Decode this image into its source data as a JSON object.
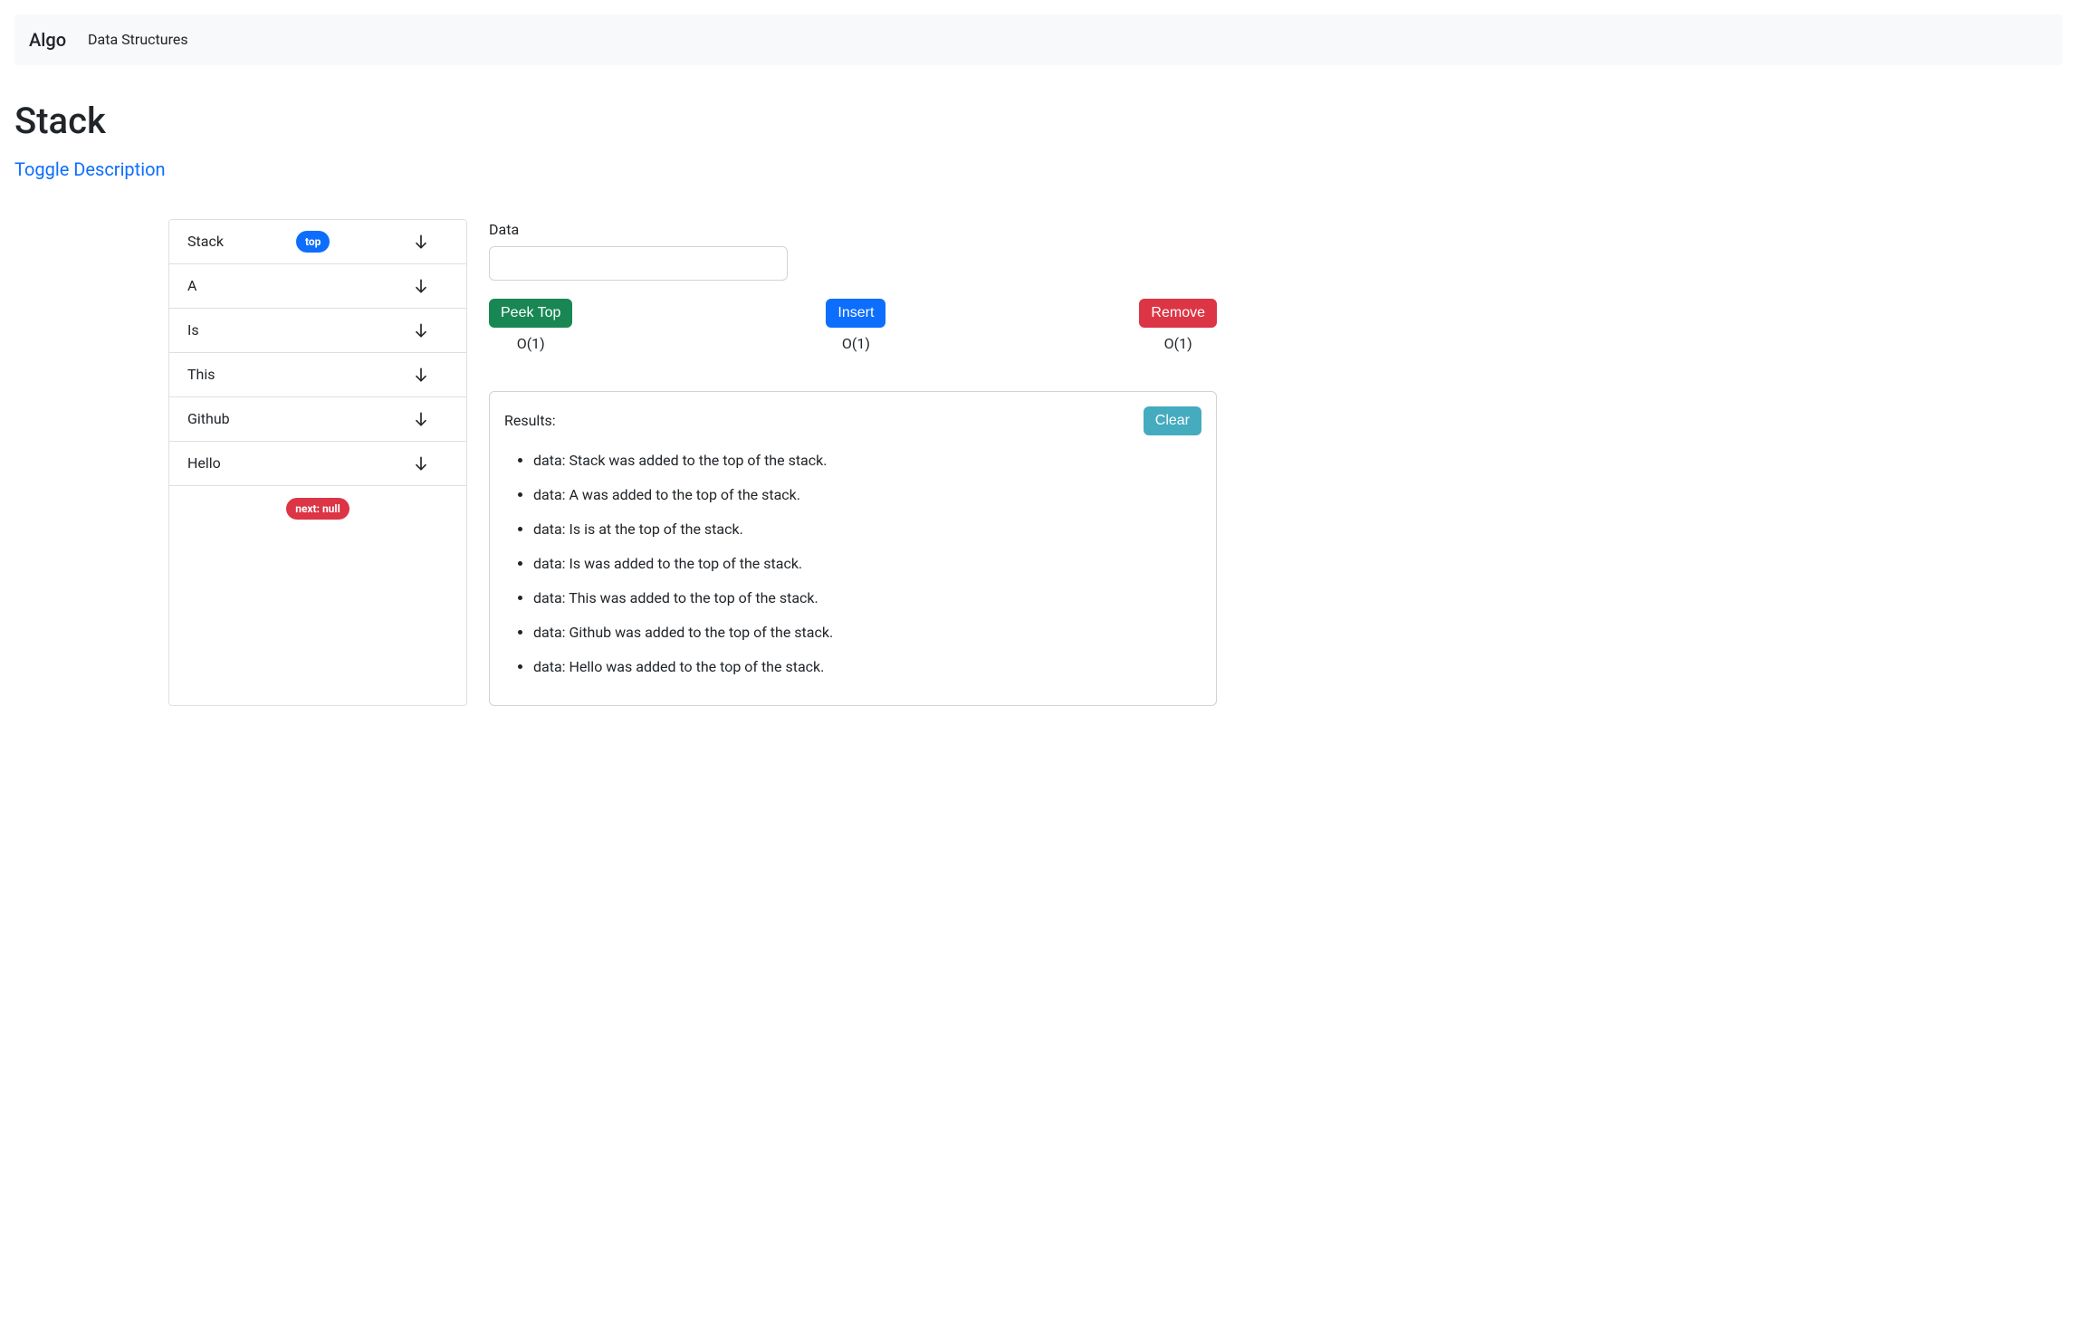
{
  "nav": {
    "brand": "Algo",
    "link": "Data Structures"
  },
  "page": {
    "title": "Stack",
    "toggle": "Toggle Description"
  },
  "stack": {
    "top_badge": "top",
    "next_null_badge": "next: null",
    "items": [
      {
        "value": "Stack",
        "is_top": true
      },
      {
        "value": "A",
        "is_top": false
      },
      {
        "value": "Is",
        "is_top": false
      },
      {
        "value": "This",
        "is_top": false
      },
      {
        "value": "Github",
        "is_top": false
      },
      {
        "value": "Hello",
        "is_top": false
      }
    ]
  },
  "form": {
    "data_label": "Data",
    "data_value": ""
  },
  "actions": {
    "peek": {
      "label": "Peek Top",
      "complexity": "O(1)"
    },
    "insert": {
      "label": "Insert",
      "complexity": "O(1)"
    },
    "remove": {
      "label": "Remove",
      "complexity": "O(1)"
    }
  },
  "results": {
    "title": "Results:",
    "clear": "Clear",
    "items": [
      "data: Stack was added to the top of the stack.",
      "data: A was added to the top of the stack.",
      "data: Is is at the top of the stack.",
      "data: Is was added to the top of the stack.",
      "data: This was added to the top of the stack.",
      "data: Github was added to the top of the stack.",
      "data: Hello was added to the top of the stack."
    ]
  }
}
